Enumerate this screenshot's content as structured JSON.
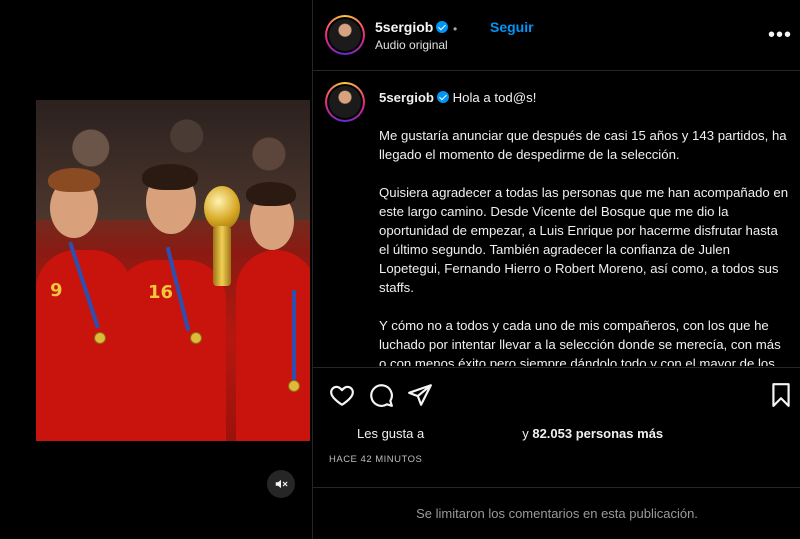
{
  "media": {
    "mute_icon": "speaker-muted-icon"
  },
  "post": {
    "username": "5sergiob",
    "separator": "•",
    "follow_label": "Seguir",
    "audio_label": "Audio original",
    "more_icon": "more-options-icon",
    "more_glyph": "•••"
  },
  "caption": {
    "username": "5sergiob",
    "greeting": "Hola a tod@s!",
    "paragraphs": [
      "Me gustaría anunciar que después de casi 15 años y 143 partidos, ha llegado el momento de despedirme de la selección.",
      "Quisiera agradecer a todas las personas que me han acompañado en este largo camino. Desde Vicente del Bosque que me dio la oportunidad de empezar, a Luis Enrique por hacerme disfrutar hasta el último segundo. También agradecer la confianza de Julen Lopetegui, Fernando Hierro o Robert Moreno, así como, a todos sus staffs.",
      "Y cómo no a todos y cada uno de mis compañeros, con los que he luchado por intentar llevar a la selección donde se merecía, con más o con menos éxito pero siempre dándolo todo y con el mayor de los orgullos."
    ]
  },
  "actions": {
    "like_icon": "heart-icon",
    "comment_icon": "comment-icon",
    "share_icon": "share-icon",
    "save_icon": "bookmark-icon",
    "likes_prefix": "Les gusta a",
    "likes_middle": "y",
    "likes_count": "82.053 personas más",
    "timestamp": "HACE 42 MINUTOS"
  },
  "comments": {
    "notice": "Se limitaron los comentarios en esta publicación."
  },
  "colors": {
    "background": "#000000",
    "accent": "#0095f6",
    "border": "#262626"
  }
}
